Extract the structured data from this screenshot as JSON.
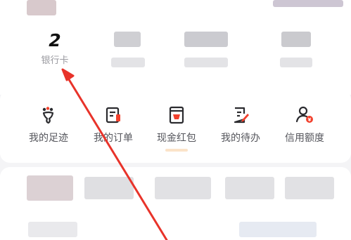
{
  "stats": [
    {
      "count": "",
      "label": ""
    },
    {
      "count": "2",
      "label": "银行卡"
    },
    {
      "count": "",
      "label": ""
    }
  ],
  "quick_entries": [
    {
      "label": "我的足迹",
      "icon": "footprint-icon"
    },
    {
      "label": "我的订单",
      "icon": "order-icon"
    },
    {
      "label": "现金红包",
      "icon": "red-envelope-icon"
    },
    {
      "label": "我的待办",
      "icon": "todo-icon"
    },
    {
      "label": "信用额度",
      "icon": "credit-limit-icon"
    }
  ],
  "colors": {
    "accent": "#f2402c",
    "icon_dark": "#2b2b2f",
    "annotation_arrow": "#e8332a"
  }
}
